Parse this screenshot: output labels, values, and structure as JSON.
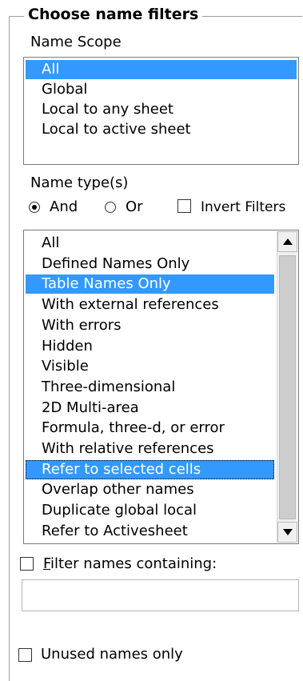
{
  "group": {
    "title": "Choose name filters"
  },
  "name_scope": {
    "label": "Name Scope",
    "items": [
      "All",
      "Global",
      "Local to any sheet",
      "Local to active sheet"
    ],
    "selected_index": 0
  },
  "name_type": {
    "label": "Name type(s)",
    "and_label": "And",
    "or_label": "Or",
    "selected": "And",
    "invert_label": "Invert Filters",
    "invert_checked": false
  },
  "type_list": {
    "items": [
      "All",
      "Defined Names Only",
      "Table Names Only",
      "With external references",
      "With errors",
      "Hidden",
      "Visible",
      "Three-dimensional",
      "2D Multi-area",
      "Formula, three-d, or error",
      "With relative references",
      "Refer to selected cells",
      "Overlap other names",
      "Duplicate global local",
      "Refer to Activesheet"
    ],
    "selected_indices": [
      2,
      11
    ],
    "focused_index": 11,
    "scroll_up_icon": "arrow-up-icon",
    "scroll_down_icon": "arrow-down-icon"
  },
  "filter_names": {
    "label_accel": "F",
    "label_rest": "ilter names containing:",
    "checked": false,
    "value": ""
  },
  "unused": {
    "label": "Unused names only",
    "checked": false
  }
}
